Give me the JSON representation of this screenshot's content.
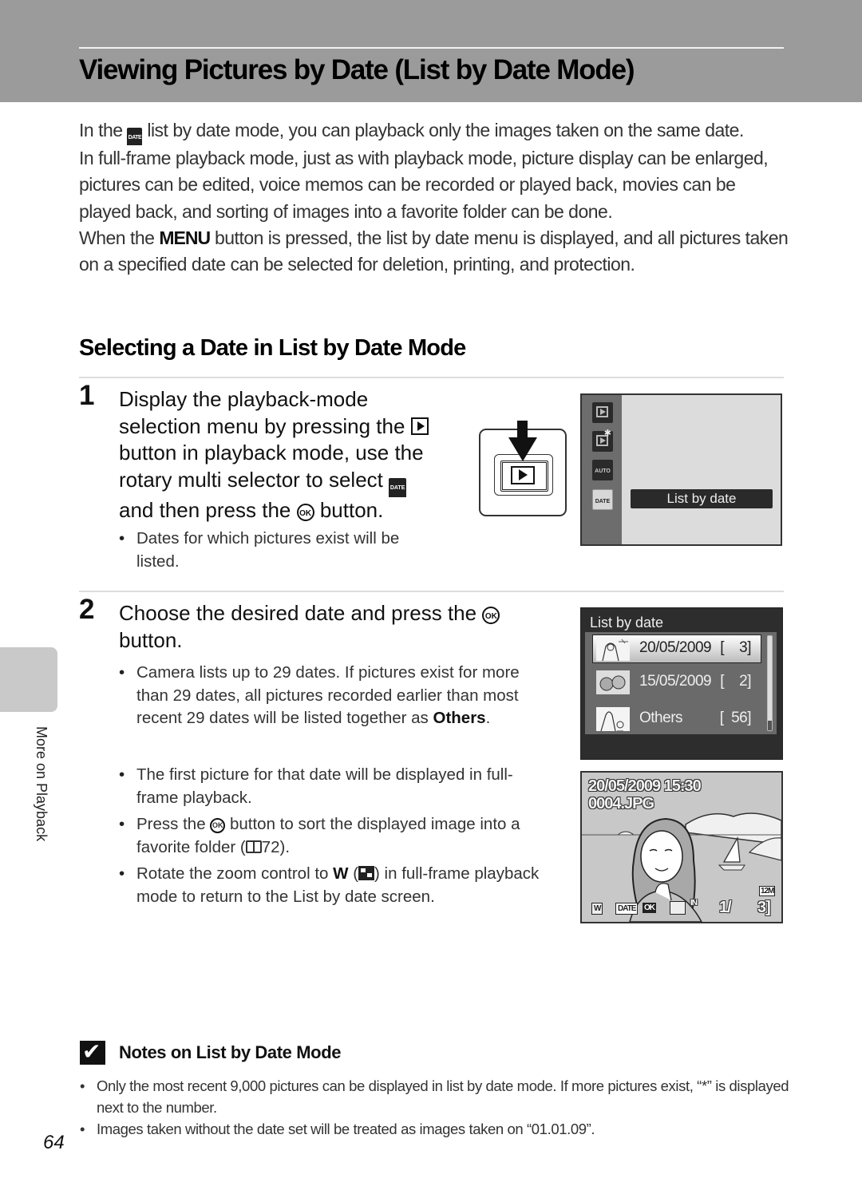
{
  "header": {
    "title": "Viewing Pictures by Date (List by Date Mode)"
  },
  "intro": {
    "p1_before": "In the ",
    "p1_icon": "DATE",
    "p1_after": " list by date mode, you can playback only the images taken on the same date.",
    "p2": "In full-frame playback mode, just as with playback mode, picture display can be enlarged, pictures can be edited, voice memos can be recorded or played back, movies can be played back, and sorting of images into a favorite folder can be done.",
    "p3_before": "When the ",
    "p3_icon": "MENU",
    "p3_after": " button is pressed, the list by date menu is displayed, and all pictures taken on a specified date can be selected for deletion, printing, and protection."
  },
  "section": {
    "title": "Selecting a Date in List by Date Mode"
  },
  "step1": {
    "number": "1",
    "text_a": "Display the playback-mode selection menu by pressing the ",
    "text_b": " button in playback mode, use the rotary multi selector to select ",
    "date_icon": "DATE",
    "text_c": " and then press the ",
    "ok_icon": "OK",
    "text_d": " button.",
    "bullets": [
      "Dates for which pictures exist will be listed."
    ],
    "screen": {
      "modes": [
        {
          "icon": "playback-icon",
          "label": ""
        },
        {
          "icon": "favorite-pictures-icon",
          "label": ""
        },
        {
          "icon": "auto-sort-icon",
          "label": "AUTO"
        },
        {
          "icon": "list-by-date-icon",
          "label": "DATE"
        }
      ],
      "selected_label": "List by date"
    }
  },
  "step2": {
    "number": "2",
    "text_a": "Choose the desired date and press the ",
    "ok_icon": "OK",
    "text_b": " button.",
    "bullet1_a": "Camera lists up to 29 dates. If pictures exist for more than 29 dates, all pictures recorded earlier than most recent 29 dates will be listed together as ",
    "bullet1_bold": "Others",
    "bullet1_b": ".",
    "bullet2": "The first picture for that date will be displayed in full-frame playback.",
    "bullet3_a": "Press the ",
    "bullet3_b": " button to sort the displayed image into a favorite folder (",
    "bullet3_ref": "72",
    "bullet3_c": ").",
    "bullet4_a": "Rotate the zoom control to ",
    "bullet4_w": "W",
    "bullet4_b": " (",
    "bullet4_c": ") in full-frame playback mode to return to the List by date screen.",
    "list_screen": {
      "title": "List by date",
      "rows": [
        {
          "date": "20/05/2009",
          "count": "[    3]",
          "selected": true
        },
        {
          "date": "15/05/2009",
          "count": "[    2]",
          "selected": false
        },
        {
          "date": "Others",
          "count": "[  56]",
          "selected": false
        }
      ]
    },
    "playback_screen": {
      "datetime": "20/05/2009 15:30",
      "filename": "0004.JPG",
      "image_size": "12M",
      "w_label": "W",
      "date_label": "DATE",
      "ok_label": "OK",
      "memory": "IN",
      "frame_current": "1/",
      "frame_total": "3]"
    }
  },
  "sidebar": {
    "label": "More on Playback"
  },
  "notes": {
    "title": "Notes on List by Date Mode",
    "items": [
      "Only the most recent 9,000 pictures can be displayed in list by date mode. If more pictures exist, “*” is displayed next to the number.",
      "Images taken without the date set will be treated as images taken on “01.01.09”."
    ]
  },
  "footer": {
    "page_number": "64"
  }
}
